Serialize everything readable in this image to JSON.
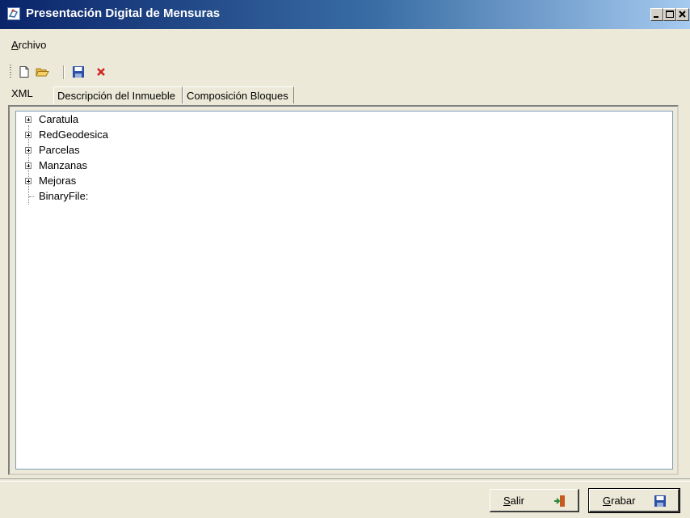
{
  "window": {
    "title": "Presentación Digital de Mensuras",
    "title_icon": "map-app-icon",
    "controls": [
      "minimize",
      "maximize",
      "close"
    ]
  },
  "menu": {
    "items": [
      {
        "label": "Archivo",
        "accel": "A",
        "rest": "rchivo"
      }
    ]
  },
  "toolbar": {
    "buttons": [
      "new-file-icon",
      "open-folder-icon",
      "save-disk-icon",
      "delete-x-icon"
    ]
  },
  "tabs": [
    {
      "label": "XML",
      "active": true
    },
    {
      "label": "Descripción del Inmueble",
      "active": false
    },
    {
      "label": "Composición Bloques",
      "active": false
    }
  ],
  "tree": {
    "nodes": [
      {
        "label": "Caratula",
        "expandable": true
      },
      {
        "label": "RedGeodesica",
        "expandable": true
      },
      {
        "label": "Parcelas",
        "expandable": true
      },
      {
        "label": "Manzanas",
        "expandable": true
      },
      {
        "label": "Mejoras",
        "expandable": true
      },
      {
        "label": "BinaryFile:",
        "expandable": false
      }
    ]
  },
  "buttons": {
    "exit": {
      "label": "Salir",
      "accel": "S",
      "rest": "alir",
      "icon": "exit-door-icon"
    },
    "save": {
      "label": "Grabar",
      "accel": "G",
      "rest": "rabar",
      "icon": "save-disk-icon"
    }
  },
  "colors": {
    "title_gradient_start": "#0a246a",
    "title_gradient_end": "#a6caf0",
    "window_background": "#ece9d8",
    "tree_background": "#ffffff"
  }
}
